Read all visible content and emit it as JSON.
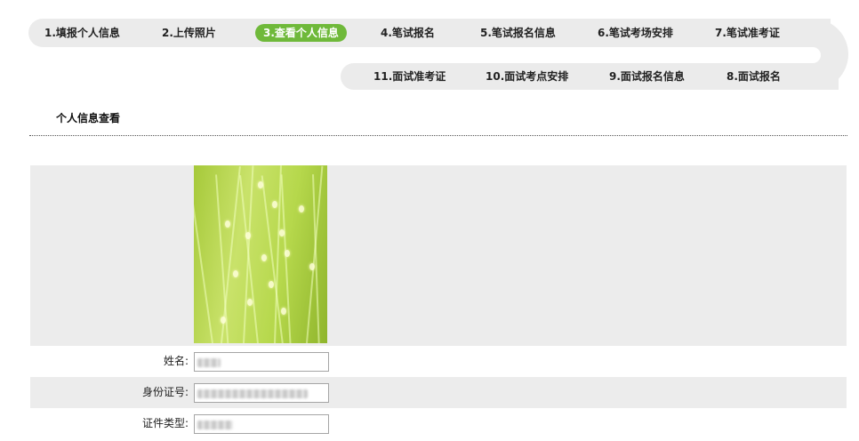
{
  "steps_top": [
    {
      "label": "1.填报个人信息",
      "active": false
    },
    {
      "label": "2.上传照片",
      "active": false
    },
    {
      "label": "3.查看个人信息",
      "active": true
    },
    {
      "label": "4.笔试报名",
      "active": false
    },
    {
      "label": "5.笔试报名信息",
      "active": false
    },
    {
      "label": "6.笔试考场安排",
      "active": false
    },
    {
      "label": "7.笔试准考证",
      "active": false
    }
  ],
  "steps_bottom": [
    {
      "label": "11.面试准考证"
    },
    {
      "label": "10.面试考点安排"
    },
    {
      "label": "9.面试报名信息"
    },
    {
      "label": "8.面试报名"
    }
  ],
  "section": {
    "title": "个人信息查看"
  },
  "form": {
    "fields": [
      {
        "label": "姓名:"
      },
      {
        "label": "身份证号:"
      },
      {
        "label": "证件类型:"
      }
    ]
  },
  "colors": {
    "active_step": "#6fb93a",
    "track": "#ebebeb",
    "row_shade": "#ececec"
  }
}
